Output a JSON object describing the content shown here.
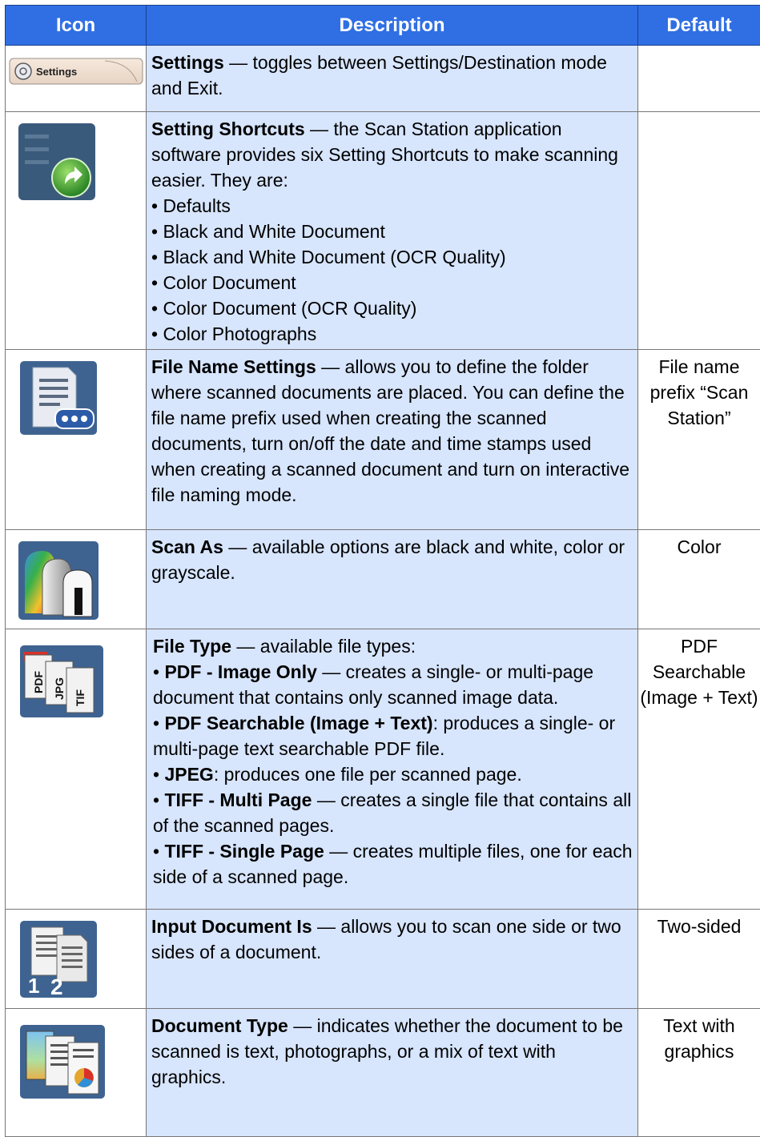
{
  "table": {
    "headers": {
      "icon": "Icon",
      "description": "Description",
      "default": "Default"
    },
    "rows": [
      {
        "icon_name": "settings-button-icon",
        "icon_label": "Settings",
        "title": "Settings",
        "text": " — toggles between Settings/Destination mode and Exit.",
        "default": ""
      },
      {
        "icon_name": "setting-shortcuts-icon",
        "title": "Setting Shortcuts",
        "text": " — the Scan Station application software provides six Setting Shortcuts to make scanning easier. They are:",
        "bullets": [
          "• Defaults",
          "• Black and White Document",
          "• Black and White Document (OCR Quality)",
          "• Color Document",
          "• Color Document (OCR Quality)",
          "• Color Photographs"
        ],
        "default": ""
      },
      {
        "icon_name": "file-name-settings-icon",
        "title": "File Name Settings",
        "text": " — allows you to define the folder where scanned documents are placed. You can define the file name prefix used when creating the scanned documents, turn on/off the date and time stamps used when creating a scanned document and turn on interactive file naming mode.",
        "default": "File name prefix “Scan Station”"
      },
      {
        "icon_name": "scan-as-icon",
        "title": "Scan As",
        "text": " — available options are black and white, color or grayscale.",
        "default": "Color"
      },
      {
        "icon_name": "file-type-icon",
        "icon_tags": [
          "PDF",
          "JPG",
          "TIF"
        ],
        "title": "File Type",
        "text": " — available file types:",
        "items": [
          {
            "bullet": "• ",
            "bold": "PDF - Image Only",
            "rest": " — creates a single- or multi-page document that contains only scanned image data."
          },
          {
            "bullet": "• ",
            "bold": "PDF Searchable (Image + Text)",
            "rest": ": produces a single- or multi-page text searchable PDF file."
          },
          {
            "bullet": "• ",
            "bold": "JPEG",
            "rest": ": produces one file per scanned page."
          },
          {
            "bullet": "•  ",
            "bold": "TIFF - Multi Page",
            "rest": " — creates a single file that contains all of the scanned pages."
          },
          {
            "bullet": "• ",
            "bold": "TIFF - Single Page",
            "rest": " — creates multiple files, one for each side of a scanned page."
          }
        ],
        "default": "PDF Searchable (Image + Text)"
      },
      {
        "icon_name": "input-document-is-icon",
        "icon_digits": [
          "1",
          "2"
        ],
        "title": "Input Document Is",
        "text": " — allows you to scan one side or two sides of a document.",
        "default": "Two-sided"
      },
      {
        "icon_name": "document-type-icon",
        "title": "Document Type",
        "text": " — indicates whether the document to be scanned is text, photographs, or a mix of text with graphics.",
        "default": "Text with graphics"
      }
    ]
  }
}
